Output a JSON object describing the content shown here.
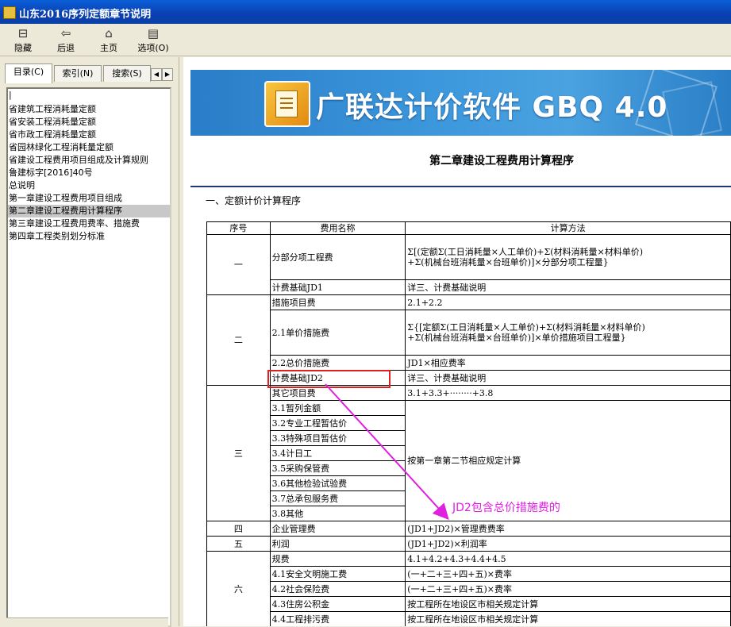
{
  "window": {
    "title": "山东2016序列定额章节说明"
  },
  "toolbar": {
    "hide": "隐藏",
    "back": "后退",
    "home": "主页",
    "options": "选项(O)"
  },
  "tabs": {
    "contents": "目录(C)",
    "index": "索引(N)",
    "search": "搜索(S)"
  },
  "toc": [
    "|",
    "省建筑工程消耗量定额",
    "省安装工程消耗量定额",
    "省市政工程消耗量定额",
    "省园林绿化工程消耗量定额",
    "省建设工程费用项目组成及计算规则",
    "鲁建标字[2016]40号",
    "总说明",
    "第一章建设工程费用项目组成",
    "第二章建设工程费用计算程序",
    "第三章建设工程费用费率、措施费",
    "第四章工程类别划分标准"
  ],
  "banner": {
    "title": "广联达计价软件 GBQ 4.0"
  },
  "chapter": {
    "title": "第二章建设工程费用计算程序",
    "section": "一、定额计价计算程序"
  },
  "table": {
    "headers": [
      "序号",
      "费用名称",
      "计算方法"
    ],
    "rows": {
      "r1_no": "一",
      "r1a_name": "分部分项工程费",
      "r1a_method_1": "Σ[(定额Σ(工日消耗量×人工单价)+Σ(材料消耗量×材料单价)",
      "r1a_method_2": "+Σ(机械台班消耗量×台班单价)]×分部分项工程量}",
      "r1b_name": "计费基础JD1",
      "r1b_method": "详三、计费基础说明",
      "r2_no": "二",
      "r2a_name": "措施项目费",
      "r2a_method": "2.1+2.2",
      "r2b_name": "2.1单价措施费",
      "r2b_method_1": "Σ{[定额Σ(工日消耗量×人工单价)+Σ(材料消耗量×材料单价)",
      "r2b_method_2": "+Σ(机械台班消耗量×台班单价)]×单价措施项目工程量}",
      "r2c_name": "2.2总价措施费",
      "r2c_method": "JD1×相应费率",
      "r2d_name": "计费基础JD2",
      "r2d_method": "详三、计费基础说明",
      "r3_no": "三",
      "r3a_name": "其它项目费",
      "r3a_method": "3.1+3.3+········+3.8",
      "r3_names": [
        "3.1暂列金额",
        "3.2专业工程暂估价",
        "3.3特殊项目暂估价",
        "3.4计日工",
        "3.5采购保管费",
        "3.6其他检验试验费",
        "3.7总承包服务费",
        "3.8其他"
      ],
      "r3_method": "按第一章第二节相应规定计算",
      "r4_no": "四",
      "r4_name": "企业管理费",
      "r4_method": "(JD1+JD2)×管理费费率",
      "r5_no": "五",
      "r5_name": "利润",
      "r5_method": "(JD1+JD2)×利润率",
      "r6_no": "六",
      "r6a_name": "规费",
      "r6a_method": "4.1+4.2+4.3+4.4+4.5",
      "r6b_name": "4.1安全文明施工费",
      "r6b_method": "(一+二+三+四+五)×费率",
      "r6c_name": "4.2社会保险费",
      "r6c_method": "(一+二+三+四+五)×费率",
      "r6d_name": "4.3住房公积金",
      "r6d_method": "按工程所在地设区市相关规定计算",
      "r6e_name": "4.4工程排污费",
      "r6e_method": "按工程所在地设区市相关规定计算"
    }
  },
  "annotation": {
    "text": "JD2包含总价措施费的",
    "color": "#e020e0"
  },
  "colors": {
    "titlebar": "#0a4fc8",
    "banner": "#3c97dc",
    "highlight": "#e02020"
  }
}
